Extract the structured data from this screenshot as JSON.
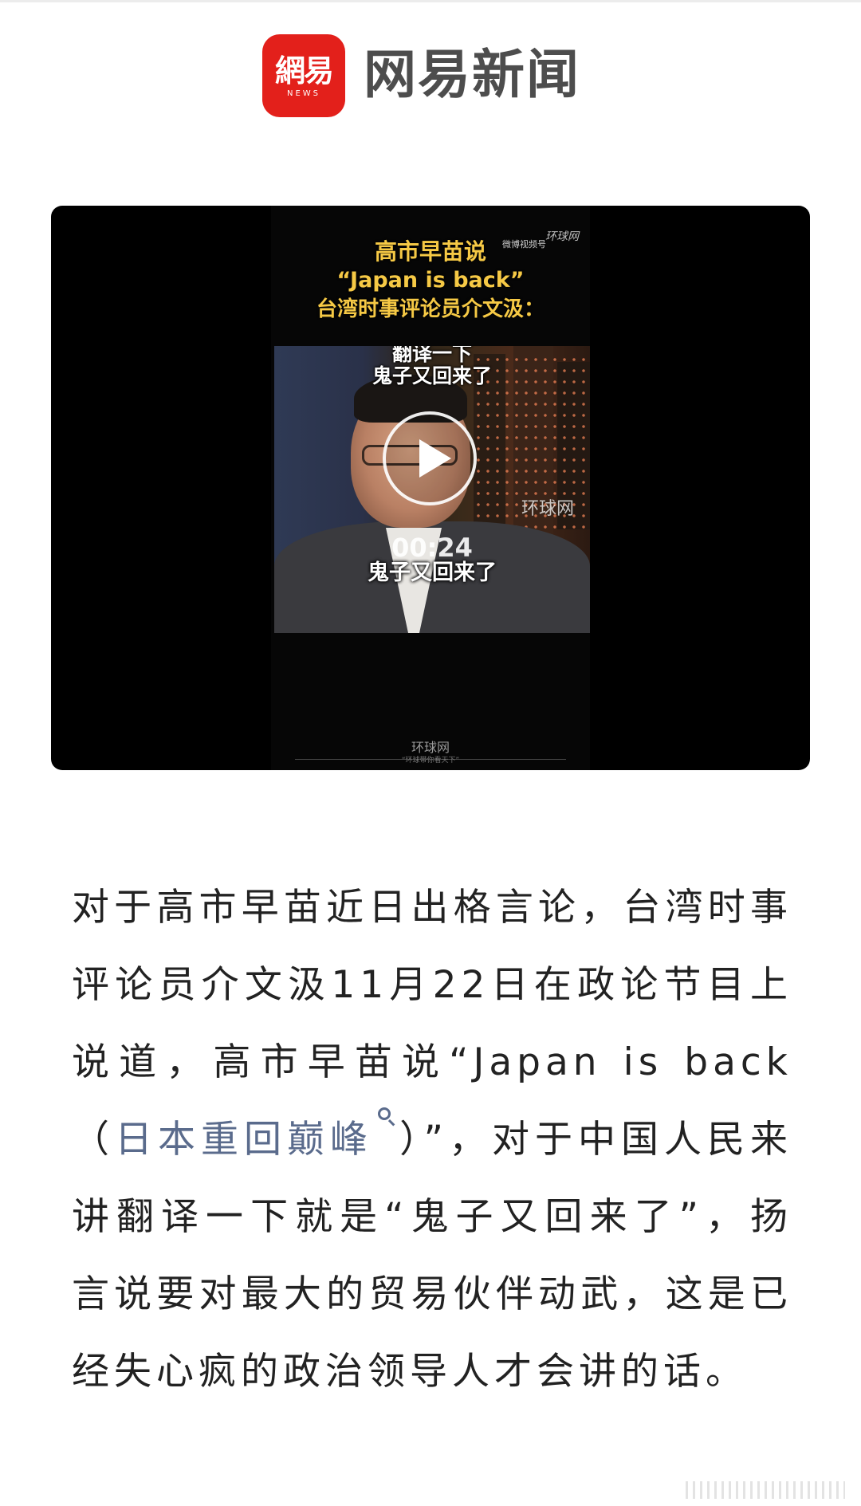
{
  "header": {
    "logo_glyph": "網易",
    "logo_sub": "NEWS",
    "brand_name": "网易新闻"
  },
  "video": {
    "title_line1": "高市早苗说",
    "title_line2": "“Japan is back”",
    "title_line3": "台湾时事评论员介文汲：",
    "caption_top1": "翻译一下",
    "caption_top2": "鬼子又回来了",
    "caption_bottom": "鬼子又回来了",
    "duration": "00:24",
    "watermark_weibo": "微博视频号",
    "watermark_huanqiu": "环球网",
    "frame_watermark": "环球网",
    "footer_logo": "环球网",
    "footer_tag": "“环球带你看天下”"
  },
  "article": {
    "text_before_link": "对于高市早苗近日出格言论，台湾时事评论员介文汲11月22日在政论节目上说道，高市早苗说“Japan is back（",
    "link_text": "日本重回巅峰",
    "text_after_link": "）”，对于中国人民来讲翻译一下就是“鬼子又回来了”，扬言说要对最大的贸易伙伴动武，这是已经失心疯的政治领导人才会讲的话。"
  }
}
